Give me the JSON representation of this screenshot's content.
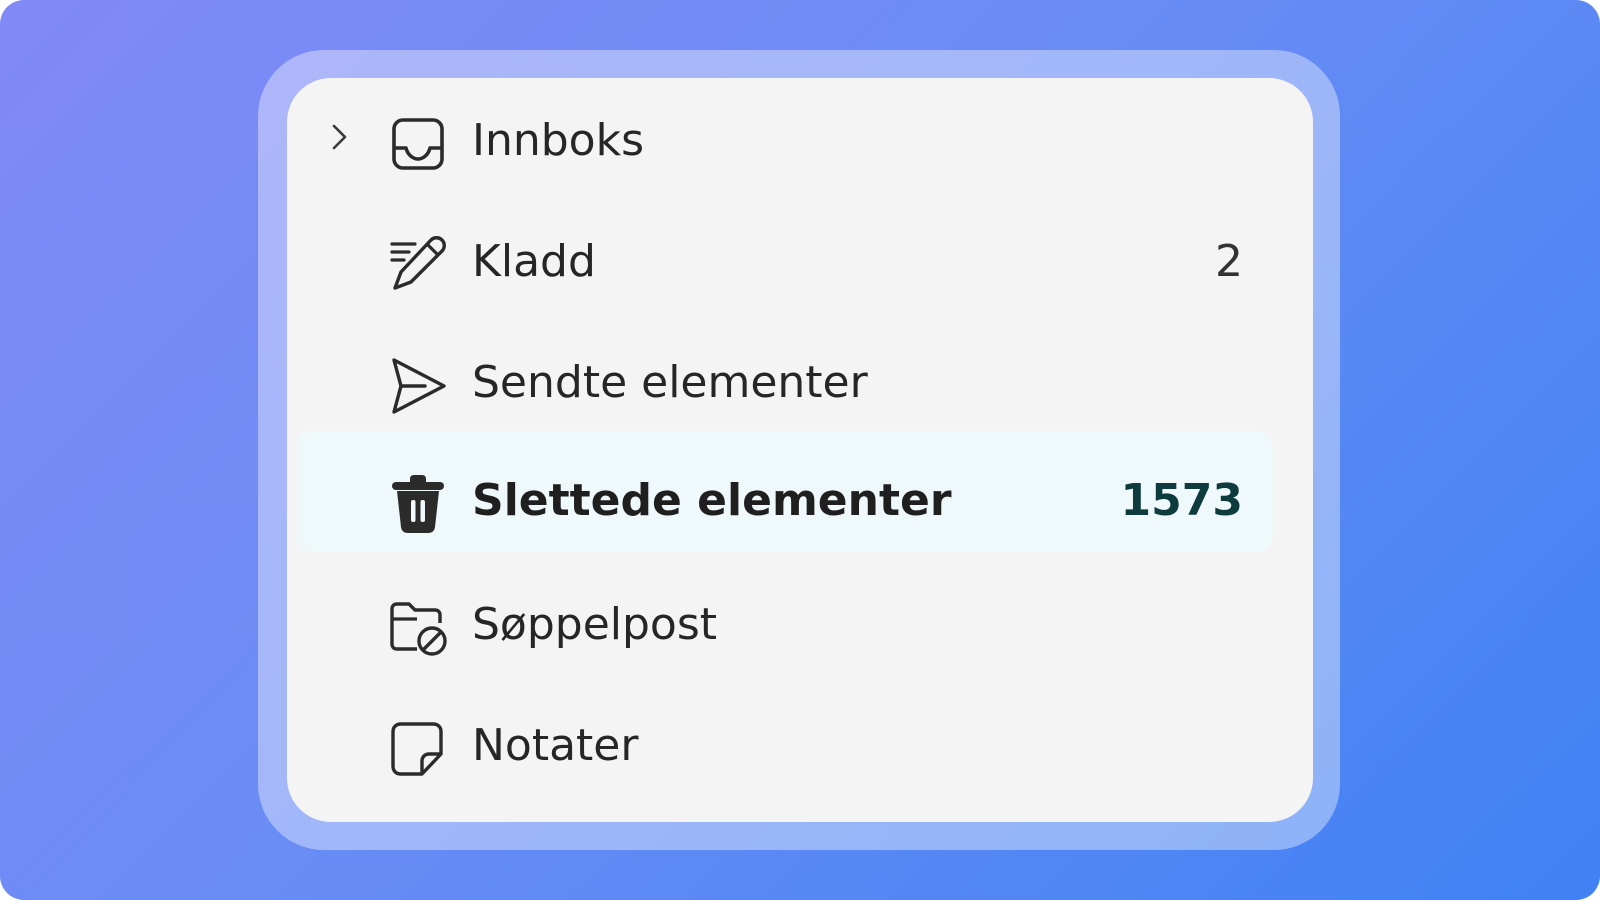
{
  "folders": [
    {
      "label": "Innboks",
      "count": "",
      "icon": "inbox-icon",
      "has_chevron": true,
      "selected": false
    },
    {
      "label": "Kladd",
      "count": "2",
      "icon": "draft-pencil-icon",
      "has_chevron": false,
      "selected": false
    },
    {
      "label": "Sendte elementer",
      "count": "",
      "icon": "send-icon",
      "has_chevron": false,
      "selected": false
    },
    {
      "label": "Slettede elementer",
      "count": "1573",
      "icon": "trash-icon",
      "has_chevron": false,
      "selected": true
    },
    {
      "label": "Søppelpost",
      "count": "",
      "icon": "junk-folder-icon",
      "has_chevron": false,
      "selected": false
    },
    {
      "label": "Notater",
      "count": "",
      "icon": "note-icon",
      "has_chevron": false,
      "selected": false
    }
  ],
  "colors": {
    "background_start": "#8189f6",
    "background_end": "#3f82f3",
    "panel": "#f4f4f4",
    "selected_row": "#eff8fa",
    "selected_count": "#0d3b3e"
  }
}
